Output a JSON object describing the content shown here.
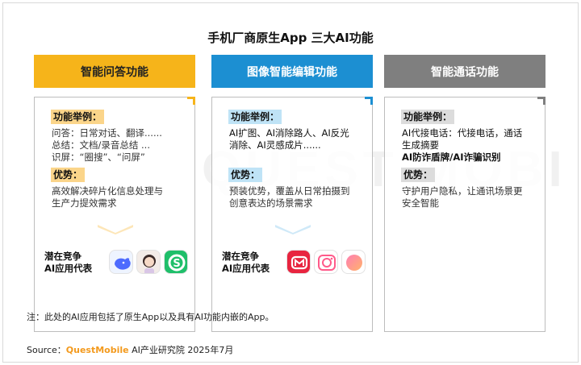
{
  "title": "手机厂商原生App 三大AI功能",
  "watermark": "QUEST MOBILE",
  "columns": [
    {
      "header": "智能问答功能",
      "example_tag": "功能举例：",
      "example_lines": [
        "问答：日常对话、翻译......",
        "总结：文档/录音总结 ...",
        "识屏：“圈搜”、“问屏”"
      ],
      "advantage_tag": "优势：",
      "advantage_lines": [
        "高效解决碎片化信息处理与",
        "生产力提效需求"
      ],
      "rep_label": [
        "潜在竞争",
        "AI应用代表"
      ],
      "apps": [
        "whale-app-icon",
        "avatar-app-icon",
        "green-s-app-icon"
      ],
      "color": "#f6b41a"
    },
    {
      "header": "图像智能编辑功能",
      "example_tag": "功能举例：",
      "example_lines": [
        "AI扩图、AI消除路人、AI反光",
        "消除、AI灵感成片......"
      ],
      "advantage_tag": "优势：",
      "advantage_lines": [
        "预装优势，覆盖从日常拍摄到",
        "创意表达的场景需求"
      ],
      "rep_label": [
        "潜在竞争",
        "AI应用代表"
      ],
      "apps": [
        "red-camera-app-icon",
        "pink-camera-app-icon",
        "gradient-circle-app-icon"
      ],
      "color": "#1c8fd2"
    },
    {
      "header": "智能通话功能",
      "example_tag": "功能举例：",
      "example_lines": [
        "AI代接电话：代接电话，通话",
        "生成摘要",
        "AI防诈盾牌/AI诈骗识别"
      ],
      "advantage_tag": "优势：",
      "advantage_lines": [
        "守护用户隐私，让通讯场景更",
        "安全智能"
      ],
      "color": "#7f7f7f"
    }
  ],
  "note": "注：此处的AI应用包括了原生App以及具有AI功能内嵌的App。",
  "source": {
    "prefix": "Source：",
    "brand": "QuestMobile",
    "suffix": " AI产业研究院 2025年7月"
  }
}
